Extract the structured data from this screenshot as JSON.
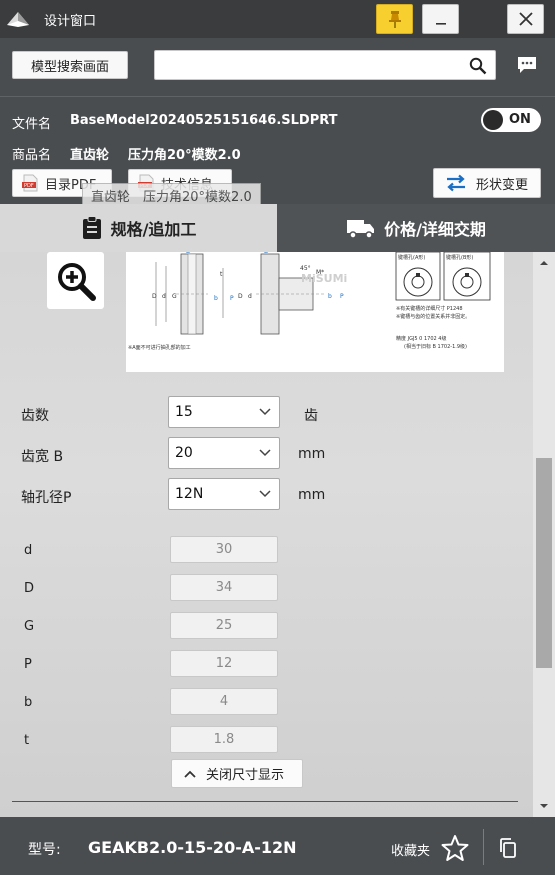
{
  "window": {
    "title": "设计窗口"
  },
  "header": {
    "search_button": "模型搜索画面",
    "search_value": "",
    "file_label": "文件名",
    "file_name": "BaseModel20240525151646.SLDPRT",
    "product_label": "商品名",
    "product_name": "直齿轮",
    "product_spec": "压力角20°模数2.0",
    "toggle_label": "ON",
    "catalog_pdf": "目录PDF",
    "tech_info": "技术信息",
    "shape_change": "形状变更",
    "tooltip": "直齿轮　压力角20°模数2.0"
  },
  "tabs": {
    "spec": "规格/追加工",
    "price": "价格/详细交期"
  },
  "fields": [
    {
      "label": "齿数",
      "value": "15",
      "unit": "齿"
    },
    {
      "label": "齿宽 B",
      "value": "20",
      "unit": "mm"
    },
    {
      "label": "轴孔径P",
      "value": "12N",
      "unit": "mm"
    }
  ],
  "dimensions": [
    {
      "label": "d",
      "value": "30"
    },
    {
      "label": "D",
      "value": "34"
    },
    {
      "label": "G",
      "value": "25"
    },
    {
      "label": "P",
      "value": "12"
    },
    {
      "label": "b",
      "value": "4"
    },
    {
      "label": "t",
      "value": "1.8"
    }
  ],
  "close_dims": "关闭尺寸显示",
  "footer": {
    "part_label": "型号:",
    "part_number": "GEAKB2.0-15-20-A-12N",
    "favorite": "收藏夹"
  },
  "drawing": {
    "note1": "※A面不可进行抽孔部的加工",
    "note2": "※有关键槽的详细尺寸 P1248",
    "note3": "※键槽与齿的位置关系并非固定。",
    "label_a": "键槽孔(A形)",
    "label_b": "键槽孔(B形)",
    "spec_line": "精度 JGJ5 0 1702 4级",
    "spec_line2": "(相当于旧标 B 1702-1.9级)",
    "brand": "MiSUMi"
  },
  "colors": {
    "titlebar": "#3a3c3e",
    "header": "#4a4d50",
    "pin": "#f7d030",
    "accent_blue": "#1a6fc4",
    "pdf_red": "#d23b2f"
  }
}
